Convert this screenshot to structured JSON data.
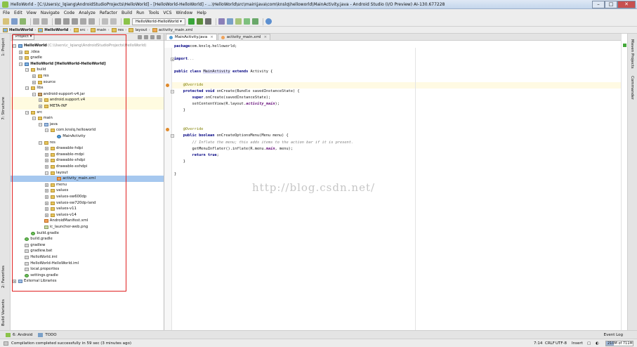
{
  "window": {
    "title": "HelloWorld - [C:\\Users\\c_lqiang\\AndroidStudioProjects\\HelloWorld] - [HelloWorld-HelloWorld] - ...\\HelloWorld\\src\\main\\java\\com\\knslq\\helloworld\\MainActivity.java - Android Studio (I/O Preview) AI-130.677228"
  },
  "menu": [
    "File",
    "Edit",
    "View",
    "Navigate",
    "Code",
    "Analyze",
    "Refactor",
    "Build",
    "Run",
    "Tools",
    "VCS",
    "Window",
    "Help"
  ],
  "toolbar": {
    "run_config": "HelloWorld-HelloWorld"
  },
  "breadcrumbs": [
    "HelloWorld",
    "HelloWorld",
    "src",
    "main",
    "res",
    "layout",
    "activity_main.xml"
  ],
  "left_tools": {
    "project": "1: Project",
    "structure": "7: Structure",
    "favorites": "2: Favorites",
    "build_variants": "Build Variants"
  },
  "project_panel": {
    "selector": "Project"
  },
  "tree": [
    {
      "depth": 0,
      "label": "HelloWorld",
      "suffix": " (C:\\Users\\c_lqiang\\AndroidStudioProjects\\HelloWorld)",
      "icon": "fm",
      "exp": "-",
      "bold": true
    },
    {
      "depth": 1,
      "label": ".idea",
      "icon": "f",
      "exp": "+"
    },
    {
      "depth": 1,
      "label": "gradle",
      "icon": "f",
      "exp": "+"
    },
    {
      "depth": 1,
      "label": "HelloWorld [HelloWorld-HelloWorld]",
      "icon": "fm",
      "exp": "-",
      "bold": true
    },
    {
      "depth": 2,
      "label": "build",
      "icon": "f",
      "exp": "-"
    },
    {
      "depth": 3,
      "label": "res",
      "icon": "f",
      "exp": "+"
    },
    {
      "depth": 3,
      "label": "source",
      "icon": "f",
      "exp": "+"
    },
    {
      "depth": 2,
      "label": "libs",
      "icon": "f",
      "exp": "-"
    },
    {
      "depth": 3,
      "label": "android-support-v4.jar",
      "icon": "jar",
      "exp": "-"
    },
    {
      "depth": 4,
      "label": "android.support.v4",
      "icon": "f",
      "exp": "+",
      "yel": true
    },
    {
      "depth": 4,
      "label": "META-INF",
      "icon": "f",
      "exp": "+",
      "yel": true
    },
    {
      "depth": 2,
      "label": "src",
      "icon": "f",
      "exp": "-"
    },
    {
      "depth": 3,
      "label": "main",
      "icon": "f",
      "exp": "-"
    },
    {
      "depth": 4,
      "label": "java",
      "icon": "fb",
      "exp": "-"
    },
    {
      "depth": 5,
      "label": "com.knslq.helloworld",
      "icon": "f",
      "exp": "-"
    },
    {
      "depth": 6,
      "label": "MainActivity",
      "icon": "jv",
      "exp": ""
    },
    {
      "depth": 4,
      "label": "res",
      "icon": "f",
      "exp": "-"
    },
    {
      "depth": 5,
      "label": "drawable-hdpi",
      "icon": "f",
      "exp": "+"
    },
    {
      "depth": 5,
      "label": "drawable-mdpi",
      "icon": "f",
      "exp": "+"
    },
    {
      "depth": 5,
      "label": "drawable-xhdpi",
      "icon": "f",
      "exp": "+"
    },
    {
      "depth": 5,
      "label": "drawable-xxhdpi",
      "icon": "f",
      "exp": "+"
    },
    {
      "depth": 5,
      "label": "layout",
      "icon": "f",
      "exp": "-"
    },
    {
      "depth": 6,
      "label": "activity_main.xml",
      "icon": "xml",
      "exp": "",
      "selected": true
    },
    {
      "depth": 5,
      "label": "menu",
      "icon": "f",
      "exp": "+"
    },
    {
      "depth": 5,
      "label": "values",
      "icon": "f",
      "exp": "+"
    },
    {
      "depth": 5,
      "label": "values-sw600dp",
      "icon": "f",
      "exp": "+"
    },
    {
      "depth": 5,
      "label": "values-sw720dp-land",
      "icon": "f",
      "exp": "+"
    },
    {
      "depth": 5,
      "label": "values-v11",
      "icon": "f",
      "exp": "+"
    },
    {
      "depth": 5,
      "label": "values-v14",
      "icon": "f",
      "exp": "+"
    },
    {
      "depth": 4,
      "label": "AndroidManifest.xml",
      "icon": "xml",
      "exp": ""
    },
    {
      "depth": 4,
      "label": "ic_launcher-web.png",
      "icon": "img",
      "exp": ""
    },
    {
      "depth": 2,
      "label": "build.gradle",
      "icon": "gr",
      "exp": ""
    },
    {
      "depth": 1,
      "label": "build.gradle",
      "icon": "gr",
      "exp": ""
    },
    {
      "depth": 1,
      "label": "gradlew",
      "icon": "fl",
      "exp": ""
    },
    {
      "depth": 1,
      "label": "gradlew.bat",
      "icon": "fl",
      "exp": ""
    },
    {
      "depth": 1,
      "label": "HelloWorld.iml",
      "icon": "fl",
      "exp": ""
    },
    {
      "depth": 1,
      "label": "HelloWorld-HelloWorld.iml",
      "icon": "fl",
      "exp": ""
    },
    {
      "depth": 1,
      "label": "local.properties",
      "icon": "fl",
      "exp": ""
    },
    {
      "depth": 1,
      "label": "settings.gradle",
      "icon": "gr",
      "exp": ""
    },
    {
      "depth": 0,
      "label": "External Libraries",
      "icon": "fb",
      "exp": "+"
    }
  ],
  "tabs": [
    {
      "label": "MainActivity.java",
      "active": true,
      "color": "#4e9cd6"
    },
    {
      "label": "activity_main.xml",
      "active": false,
      "color": "#f1a35b"
    }
  ],
  "code": [
    {
      "line": 1,
      "parts": [
        [
          "kw",
          "package"
        ],
        [
          "",
          "com.knslq.helloworld;"
        ]
      ]
    },
    {
      "line": 3,
      "fold": "+",
      "parts": [
        [
          "kw",
          "import"
        ],
        [
          "",
          ""
        ],
        [
          "cm",
          "..."
        ]
      ]
    },
    {
      "line": 5,
      "parts": [
        [
          "kw",
          "public class "
        ],
        [
          "hlcls",
          "MainActivity"
        ],
        [
          "kw",
          " extends "
        ],
        [
          "",
          "Activity {"
        ]
      ]
    },
    {
      "line": 7,
      "marker": "#e08a2c",
      "parts": [
        [
          "an",
          "    @Override"
        ]
      ]
    },
    {
      "line": 8,
      "fold": "-",
      "parts": [
        [
          "kw",
          "    protected void "
        ],
        [
          "",
          "onCreate(Bundle savedInstanceState) {"
        ]
      ]
    },
    {
      "line": 9,
      "parts": [
        [
          "kw",
          "        super"
        ],
        [
          "",
          ".onCreate(savedInstanceState);"
        ]
      ]
    },
    {
      "line": 10,
      "parts": [
        [
          "",
          "        setContentView(R.layout."
        ],
        [
          "fld",
          "activity_main"
        ],
        [
          "",
          ");"
        ]
      ]
    },
    {
      "line": 11,
      "parts": [
        [
          "",
          "    }"
        ]
      ]
    },
    {
      "line": 14,
      "marker": "#e08a2c",
      "parts": [
        [
          "an",
          "    @Override"
        ]
      ]
    },
    {
      "line": 15,
      "fold": "-",
      "parts": [
        [
          "kw",
          "    public boolean "
        ],
        [
          "",
          "onCreateOptionsMenu(Menu menu) {"
        ]
      ]
    },
    {
      "line": 16,
      "parts": [
        [
          "cm",
          "        // Inflate the menu; this adds items to the action bar if it is present."
        ]
      ]
    },
    {
      "line": 17,
      "parts": [
        [
          "",
          "        getMenuInflater().inflate(R.menu."
        ],
        [
          "fld",
          "main"
        ],
        [
          "",
          ", menu);"
        ]
      ]
    },
    {
      "line": 18,
      "parts": [
        [
          "kw",
          "        return true"
        ],
        [
          "",
          ";"
        ]
      ]
    },
    {
      "line": 19,
      "parts": [
        [
          "",
          "    }"
        ]
      ]
    },
    {
      "line": 21,
      "parts": [
        [
          "",
          "}"
        ]
      ]
    }
  ],
  "watermark": "http://blog.csdn.net/",
  "right_tools": {
    "maven": "Maven Projects",
    "commander": "Commander"
  },
  "bottom_tools": {
    "android": "6: Android",
    "todo": "TODO",
    "event_log": "Event Log"
  },
  "status": {
    "message": "Compilation completed successfully in 59 sec (3 minutes ago)",
    "position": "7:14",
    "line_sep": "CRLF",
    "encoding": "UTF-8",
    "mode": "Insert",
    "memory": "210M of 711M",
    "memory_fraction": 0.3
  }
}
